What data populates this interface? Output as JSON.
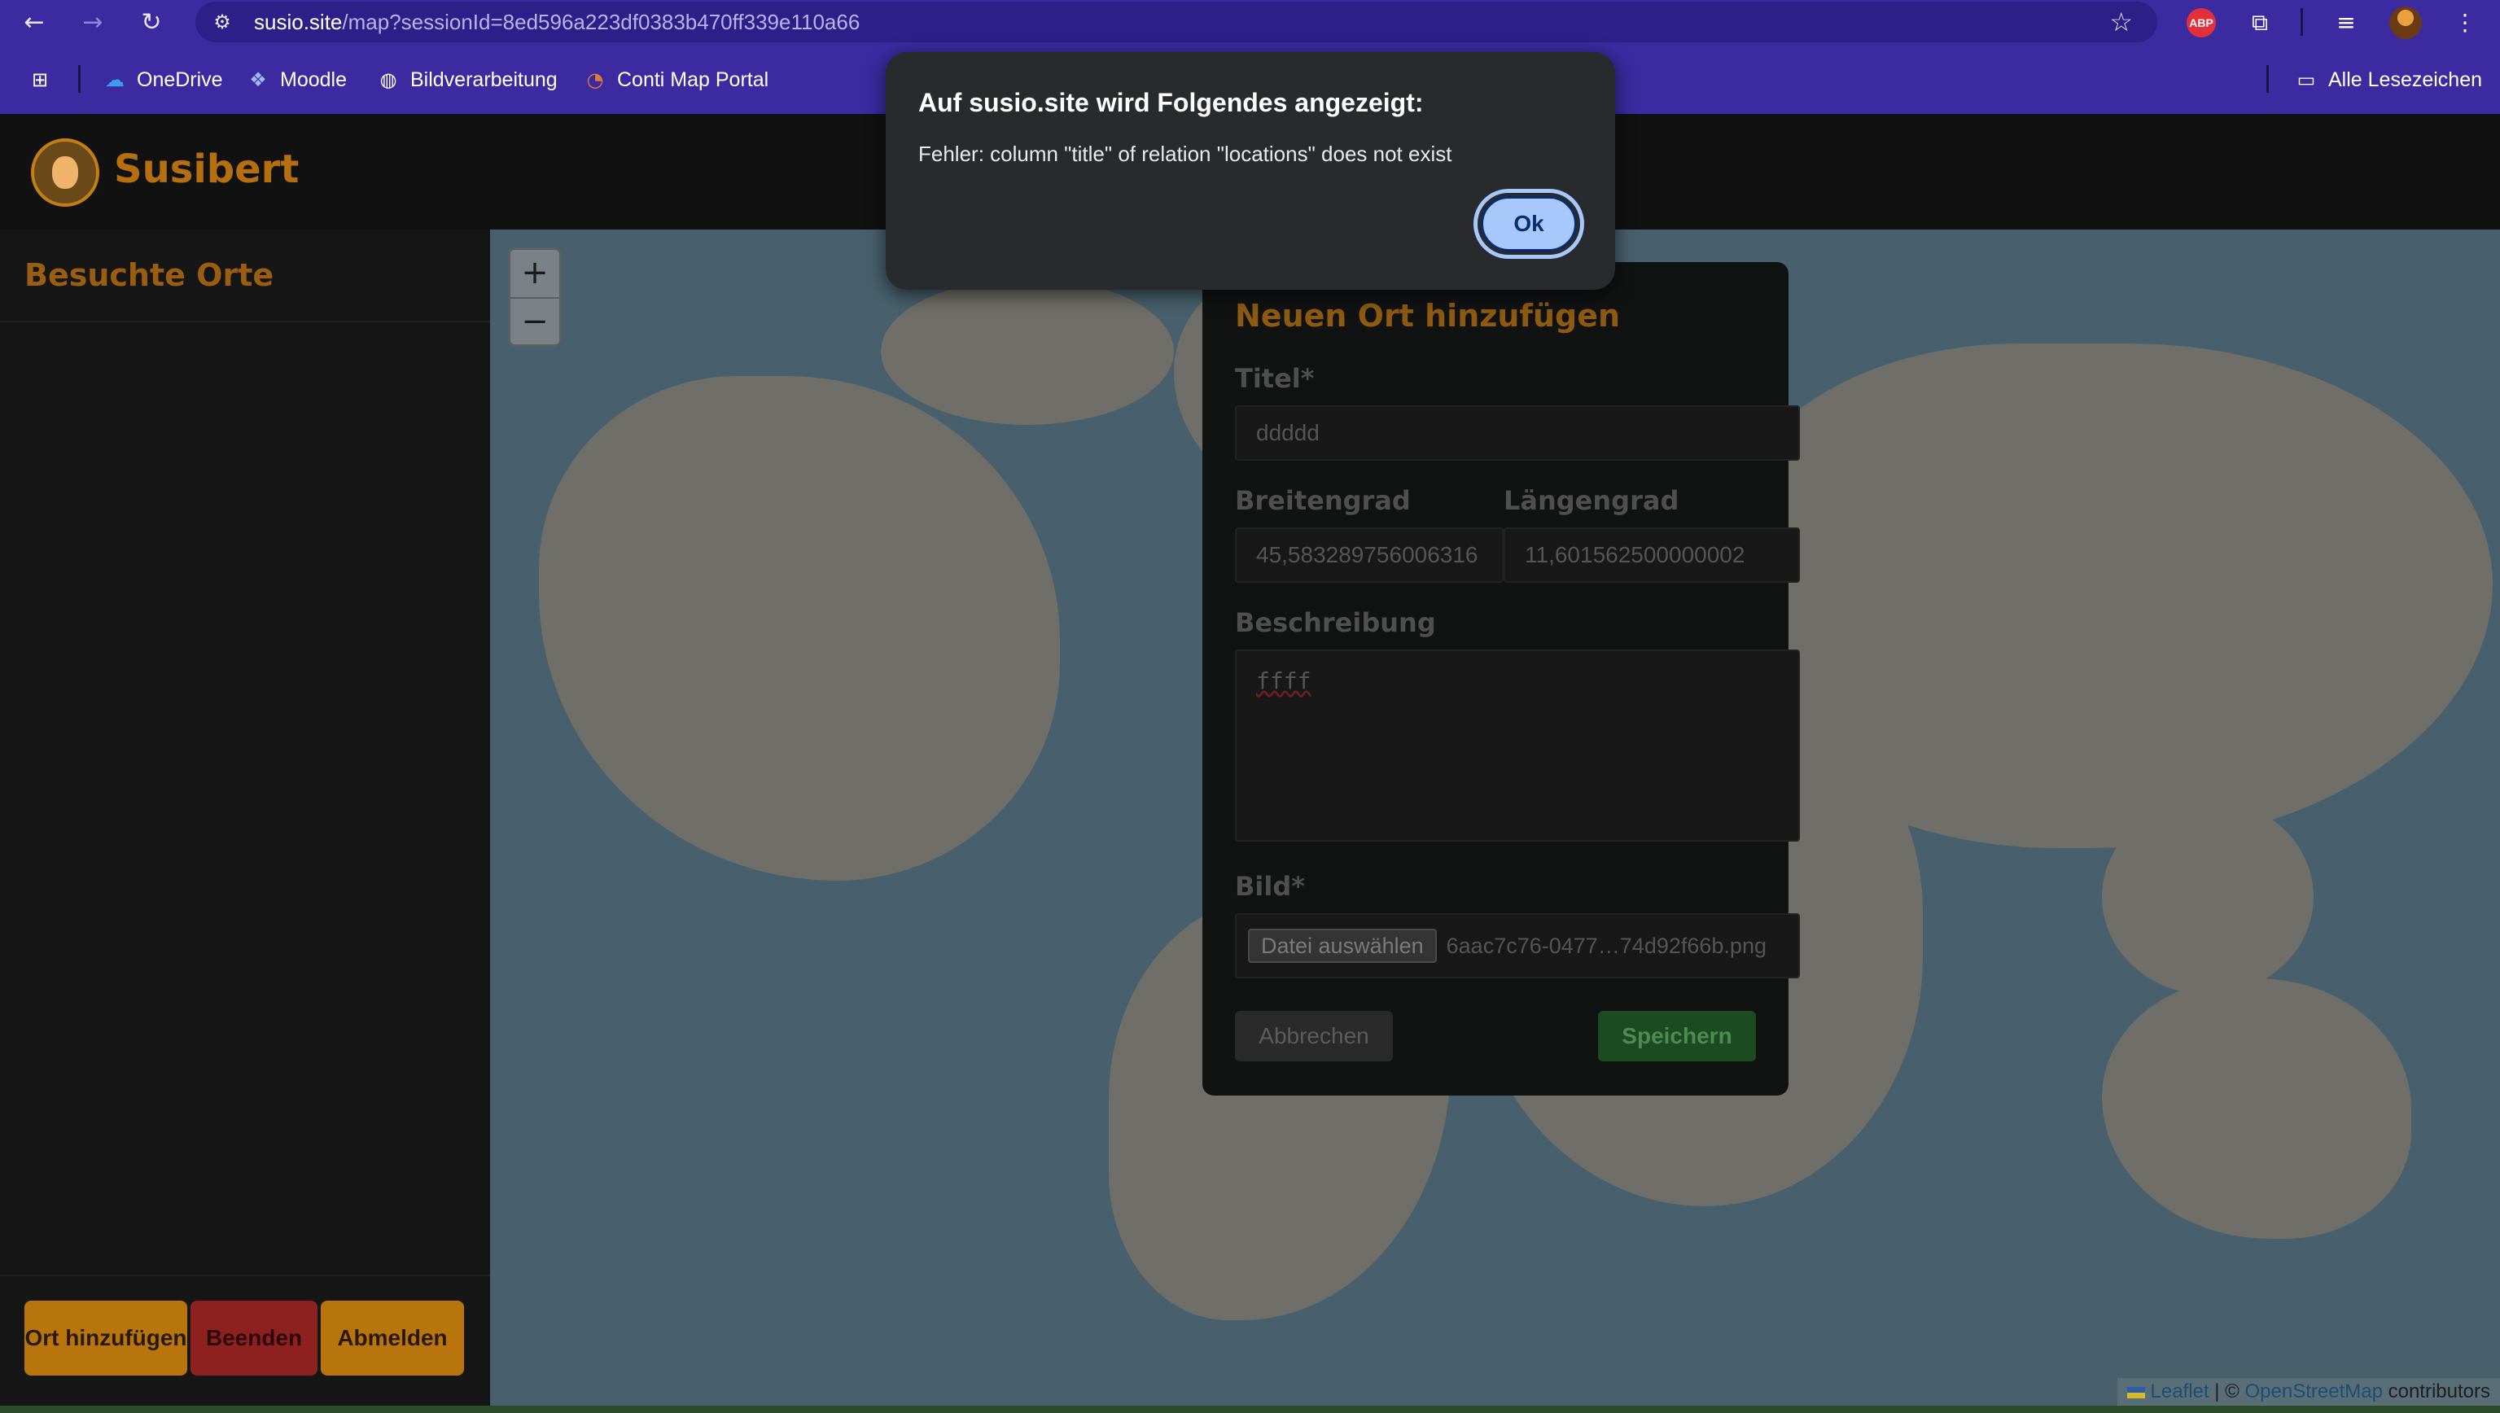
{
  "browser": {
    "url_host": "susio.site",
    "url_path": "/map?sessionId=8ed596a223df0383b470ff339e110a66",
    "extension_abp_label": "ABP",
    "bookmarks": [
      {
        "label": "OneDrive",
        "icon": "cloud-icon"
      },
      {
        "label": "Moodle",
        "icon": "moodle-icon"
      },
      {
        "label": "Bildverarbeitung",
        "icon": "globe-icon"
      },
      {
        "label": "Conti Map Portal",
        "icon": "map-portal-icon"
      }
    ],
    "all_bookmarks_label": "Alle Lesezeichen"
  },
  "app": {
    "brand": "Susibert",
    "sidebar_title": "Besuchte Orte",
    "buttons": {
      "add_place": "Ort hinzufügen",
      "end": "Beenden",
      "logout": "Abmelden"
    },
    "colors": {
      "accent": "#b56f0e",
      "end_button": "#c02b2b",
      "save_button": "#1d4b21"
    }
  },
  "map": {
    "zoom_in": "+",
    "zoom_out": "−",
    "attribution_leaflet": "Leaflet",
    "attribution_sep": "| ©",
    "attribution_osm": "OpenStreetMap",
    "attribution_contributors": "contributors"
  },
  "form": {
    "title": "Neuen Ort hinzufügen",
    "title_label": "Titel*",
    "title_value": "ddddd",
    "lat_label": "Breitengrad",
    "lat_value": "45,583289756006316",
    "lng_label": "Längengrad",
    "lng_value": "11,601562500000002",
    "desc_label": "Beschreibung",
    "desc_value": "ffff",
    "image_label": "Bild*",
    "file_button": "Datei auswählen",
    "file_name": "6aac7c76-0477…74d92f66b.png",
    "cancel": "Abbrechen",
    "save": "Speichern"
  },
  "dialog": {
    "title": "Auf susio.site wird Folgendes angezeigt:",
    "message": "Fehler: column \"title\" of relation \"locations\" does not exist",
    "ok": "Ok"
  }
}
